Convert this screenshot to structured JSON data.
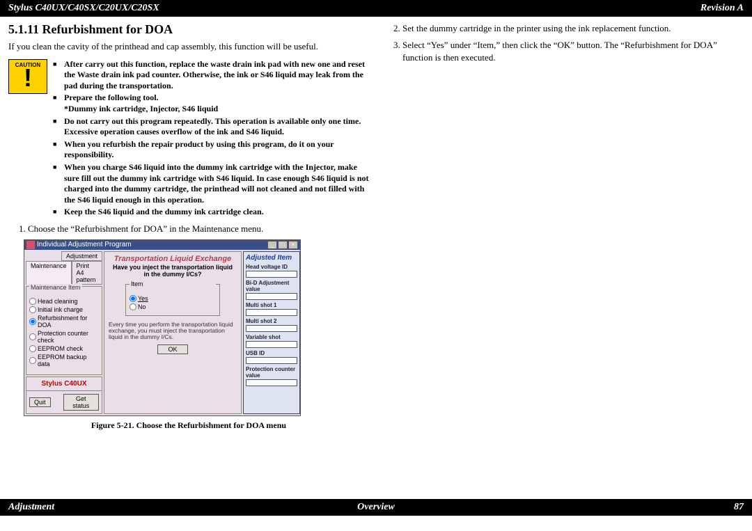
{
  "header": {
    "left": "Stylus C40UX/C40SX/C20UX/C20SX",
    "right": "Revision A"
  },
  "footer": {
    "left": "Adjustment",
    "center": "Overview",
    "right": "87"
  },
  "section_title": "5.1.11  Refurbishment for DOA",
  "intro": "If you clean the cavity of the printhead and cap assembly, this function will be useful.",
  "caution_label": "CAUTION",
  "cautions": [
    "After carry out this function, replace the waste drain ink pad with new one and reset the Waste drain ink pad counter. Otherwise, the ink or S46 liquid may leak from the pad during the transportation.",
    "Prepare the following tool.\n*Dummy ink cartridge, Injector, S46 liquid",
    "Do not carry out this program repeatedly. This operation is available only one time. Excessive operation causes overflow of the ink and S46 liquid.",
    "When you refurbish the repair product by using this program, do it on your responsibility.",
    "When you charge S46 liquid into the dummy ink cartridge with the Injector, make sure fill out the dummy ink cartridge with S46 liquid. In case enough S46 liquid is not charged into the dummy cartridge, the printhead will not cleaned and not filled with the S46 liquid enough in this operation.",
    "Keep the S46 liquid and the dummy ink cartridge clean."
  ],
  "steps_left": [
    "Choose the “Refurbishment for DOA” in the Maintenance menu."
  ],
  "steps_right_start": 2,
  "steps_right": [
    "Set the dummy cartridge in the printer using the ink replacement function.",
    "Select “Yes” under “Item,” then click the “OK” button. The “Refurbishment for DOA” function is then executed."
  ],
  "figure_caption": "Figure 5-21.  Choose the Refurbishment for DOA menu",
  "app": {
    "titlebar": "Individual Adjustment Program",
    "tab1": "Adjustment",
    "tab2": "Maintenance",
    "tab3": "Print A4 pattern",
    "maint_group": "Maintenance Item",
    "maint_opts": [
      "Head cleaning",
      "Initial ink charge",
      "Refurbishment for DOA",
      "Protection counter check",
      "EEPROM check",
      "EEPROM backup data"
    ],
    "maint_selected_index": 2,
    "model": "Stylus C40UX",
    "quit": "Quit",
    "get_status": "Get status",
    "main_title": "Transportation Liquid Exchange",
    "question": "Have you inject the transportation liquid in the dummy I/Cs?",
    "item_label": "Item",
    "yes": "Yes",
    "no": "No",
    "note": "Every time you perform the transportation liquid exchange, you must inject the transportation liquid in the dummy I/Cs.",
    "ok": "OK",
    "adjusted_title": "Adjusted Item",
    "adj_labels": [
      "Head voltage ID",
      "Bi-D Adjustment value",
      "Multi shot 1",
      "Multi shot 2",
      "Variable shot",
      "USB ID",
      "Protection counter value"
    ]
  }
}
